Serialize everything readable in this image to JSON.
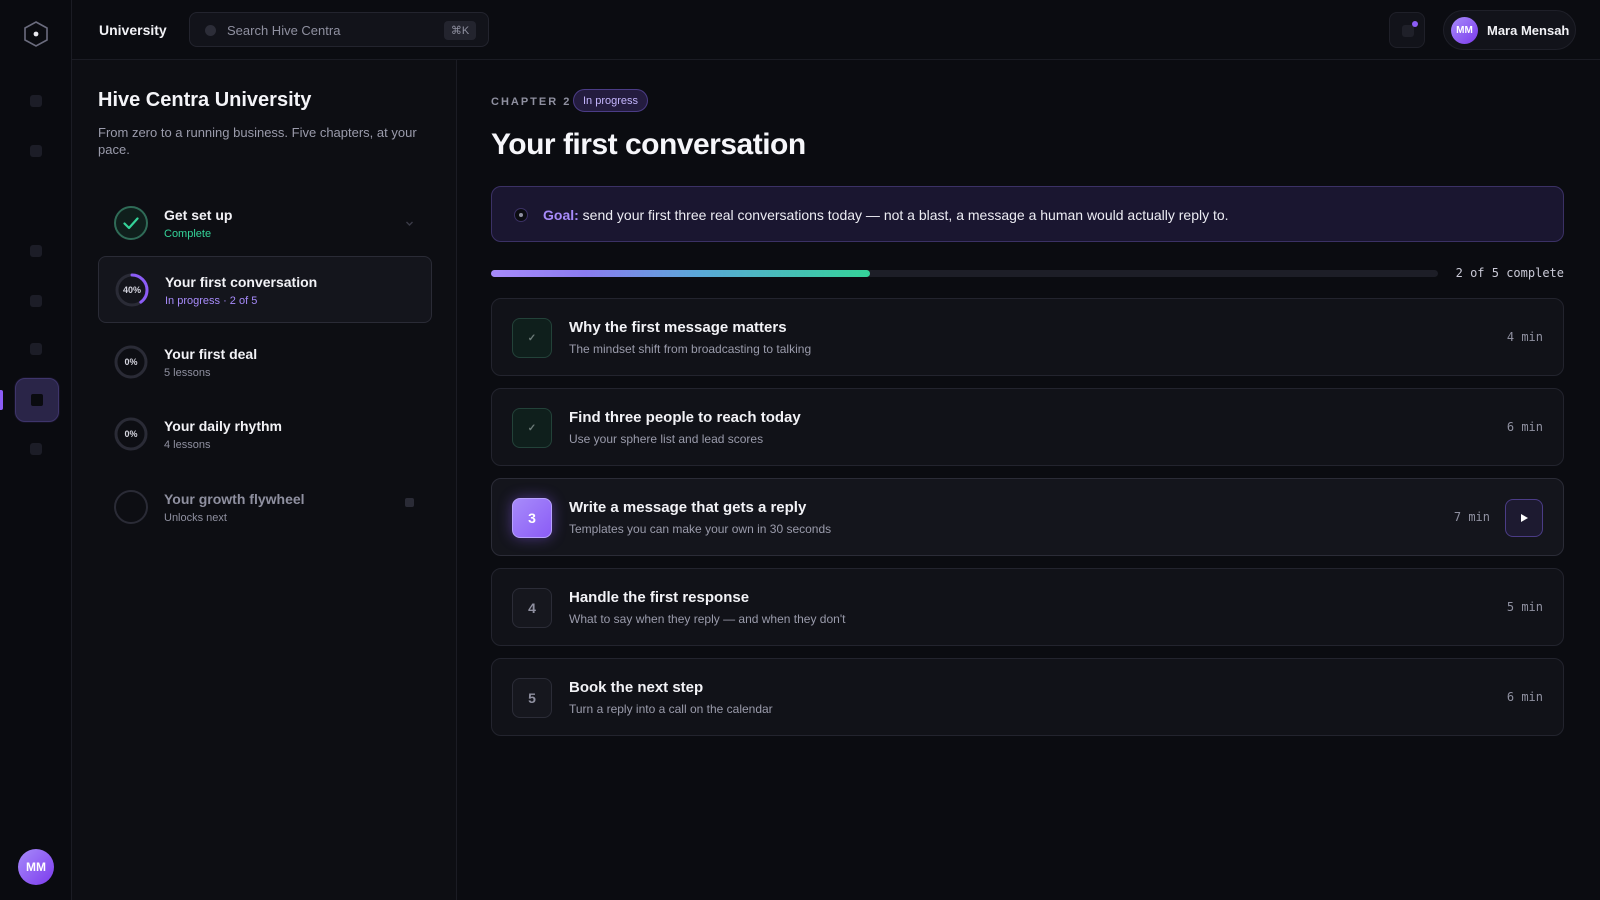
{
  "header": {
    "breadcrumb": "University",
    "search_placeholder": "Search Hive Centra",
    "search_shortcut": "⌘K",
    "user_name": "Mara Mensah",
    "user_initials": "MM"
  },
  "rail": {
    "avatar_initials": "MM",
    "accent": "#8b5cf6"
  },
  "sidebar": {
    "title": "Hive Centra University",
    "subtitle": "From zero to a running business. Five chapters, at your pace.",
    "chapters": [
      {
        "title": "Get set up",
        "status": "Complete",
        "progress_label": "",
        "progress": 1.0,
        "state": "complete"
      },
      {
        "title": "Your first conversation",
        "status": "In progress · 2 of 5",
        "progress_label": "40%",
        "progress": 0.4,
        "state": "active"
      },
      {
        "title": "Your first deal",
        "status": "5 lessons",
        "progress_label": "0%",
        "progress": 0,
        "state": "todo"
      },
      {
        "title": "Your daily rhythm",
        "status": "4 lessons",
        "progress_label": "0%",
        "progress": 0,
        "state": "todo"
      },
      {
        "title": "Your growth flywheel",
        "status": "Unlocks next",
        "progress_label": "",
        "progress": 0,
        "state": "locked"
      }
    ]
  },
  "main": {
    "eyebrow": "CHAPTER 2",
    "badge": "In progress",
    "title": "Your first conversation",
    "goal_label": "Goal:",
    "goal_text": " send your first three real conversations today — not a blast, a message a human would actually reply to.",
    "progress_fraction": 0.4,
    "progress_label": "2 of 5 complete",
    "lessons": [
      {
        "num": "✓",
        "title": "Why the first message matters",
        "subtitle": "The mindset shift from broadcasting to talking",
        "duration": "4 min",
        "state": "done"
      },
      {
        "num": "✓",
        "title": "Find three people to reach today",
        "subtitle": "Use your sphere list and lead scores",
        "duration": "6 min",
        "state": "done"
      },
      {
        "num": "3",
        "title": "Write a message that gets a reply",
        "subtitle": "Templates you can make your own in 30 seconds",
        "duration": "7 min",
        "state": "current"
      },
      {
        "num": "4",
        "title": "Handle the first response",
        "subtitle": "What to say when they reply — and when they don't",
        "duration": "5 min",
        "state": "todo"
      },
      {
        "num": "5",
        "title": "Book the next step",
        "subtitle": "Turn a reply into a call on the calendar",
        "duration": "6 min",
        "state": "todo"
      }
    ]
  },
  "colors": {
    "accent": "#8b5cf6",
    "success": "#34d399",
    "background": "#0b0c11"
  }
}
